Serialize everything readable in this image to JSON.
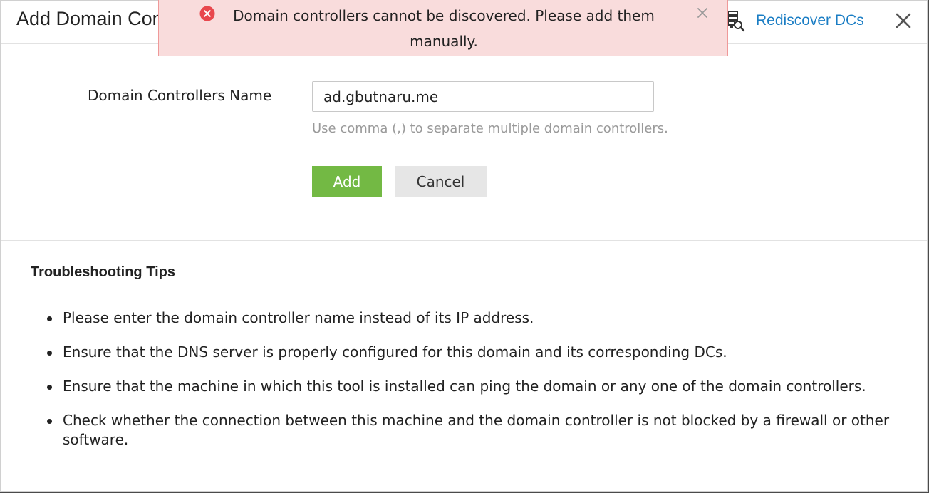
{
  "dialog": {
    "title": "Add Domain Controllers",
    "rediscover_label": "Rediscover DCs",
    "rediscover_icon": "server-search-icon",
    "close_icon": "close-icon"
  },
  "alert": {
    "message": "Domain controllers cannot be discovered. Please add them manually.",
    "icon": "error-circle-icon",
    "close_icon": "close-icon",
    "colors": {
      "background": "#f9dcdc",
      "border": "#ef9999",
      "icon": "#e8474d"
    }
  },
  "form": {
    "label": "Domain Controllers Name",
    "input_value": "ad.gbutnaru.me",
    "hint": "Use comma (,) to separate multiple domain controllers.",
    "add_label": "Add",
    "cancel_label": "Cancel"
  },
  "tips": {
    "heading": "Troubleshooting Tips",
    "items": [
      "Please enter the domain controller name instead of its IP address.",
      "Ensure that the DNS server is properly configured for this domain and its corresponding DCs.",
      "Ensure that the machine in which this tool is installed can ping the domain or any one of the domain controllers.",
      "Check whether the connection between this machine and the domain controller is not blocked by a firewall or other software."
    ]
  },
  "colors": {
    "link": "#1a7dc4",
    "primary_button": "#73b944",
    "secondary_button": "#e6e6e6"
  }
}
